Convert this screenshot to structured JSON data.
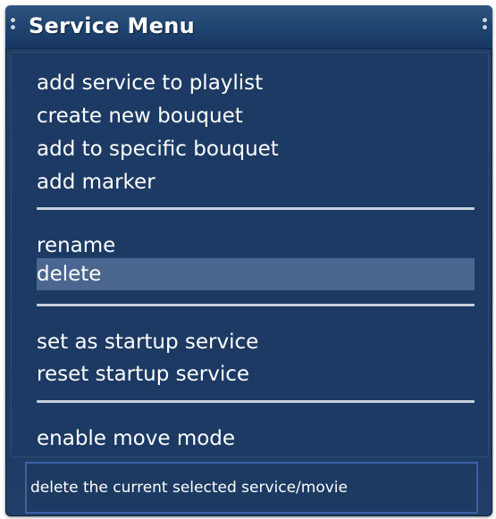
{
  "window": {
    "title": "Service Menu"
  },
  "menu": {
    "group1": [
      "add service to playlist",
      "create new bouquet",
      "add to specific bouquet",
      "add marker"
    ],
    "group2": [
      "rename",
      "delete"
    ],
    "group3": [
      "set as startup service",
      "reset startup service"
    ],
    "group4": [
      "enable move mode"
    ],
    "selected_item": "delete"
  },
  "description": {
    "text": "delete the current selected service/movie"
  },
  "colors": {
    "background": "#1d3a62",
    "selection": "#4b6790",
    "separator": "#c8d0da",
    "description_border": "#3c62a6",
    "text": "#ffffff"
  }
}
